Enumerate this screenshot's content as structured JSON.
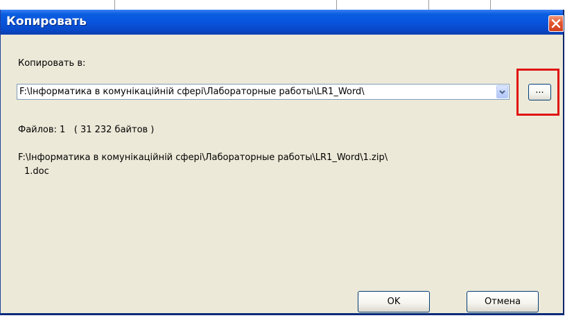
{
  "window": {
    "title": "Копировать",
    "close_icon": "close-icon"
  },
  "copy_to": {
    "label": "Копировать в:",
    "path_value": "F:\\Інформатика в комунікаційній сфері\\Лабораторные работы\\LR1_Word\\",
    "dropdown_icon": "chevron-down-icon",
    "browse_label": "..."
  },
  "info": {
    "files_label": "Файлов: 1",
    "size_text": "( 31 232 байтов )",
    "source_path": "F:\\Інформатика в комунікаційній сфері\\Лабораторные работы\\LR1_Word\\1.zip\\",
    "file_name": "1.doc"
  },
  "buttons": {
    "ok_label": "OK",
    "cancel_label": "Отмена"
  },
  "colors": {
    "titlebar": "#0854dc",
    "dialog_background": "#ece9d8",
    "highlight": "#e01010",
    "close_button": "#e2552d"
  }
}
